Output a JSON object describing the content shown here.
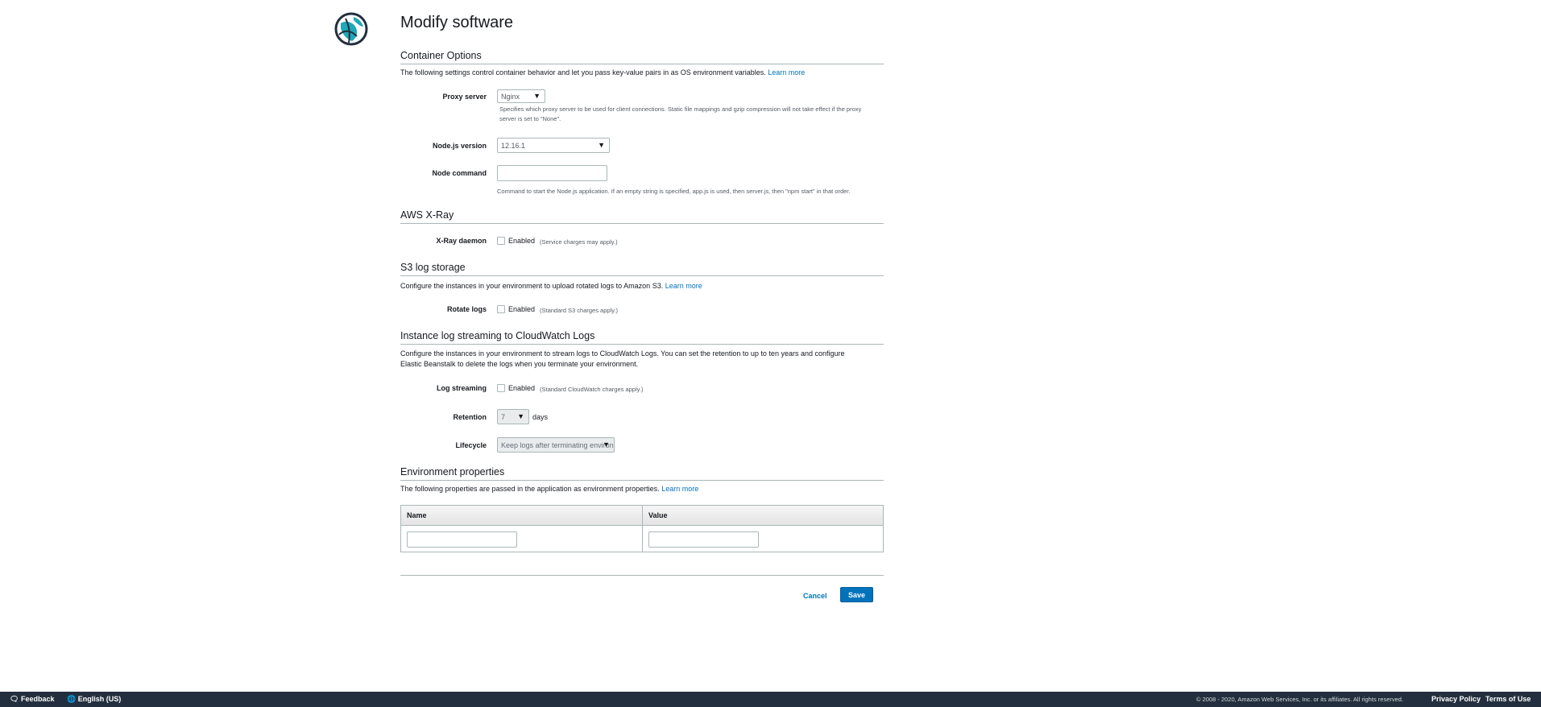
{
  "page_title": "Modify software",
  "container": {
    "heading": "Container Options",
    "description": "The following settings control container behavior and let you pass key-value pairs in as OS environment variables.",
    "learn_more": "Learn more",
    "proxy": {
      "label": "Proxy server",
      "value": "Nginx",
      "help": "Specifies which proxy server to be used for client connections. Static file mappings and gzip compression will not take effect if the proxy server is set to \"None\"."
    },
    "node_version": {
      "label": "Node.js version",
      "value": "12.16.1"
    },
    "node_command": {
      "label": "Node command",
      "value": "",
      "help": "Command to start the Node.js application. If an empty string is specified, app.js is used, then server.js, then \"npm start\" in that order."
    }
  },
  "xray": {
    "heading": "AWS X-Ray",
    "daemon": {
      "label": "X-Ray daemon",
      "checkbox_label": "Enabled",
      "checked": false,
      "note": "(Service charges may apply.)"
    }
  },
  "s3": {
    "heading": "S3 log storage",
    "description": "Configure the instances in your environment to upload rotated logs to Amazon S3.",
    "learn_more": "Learn more",
    "rotate": {
      "label": "Rotate logs",
      "checkbox_label": "Enabled",
      "checked": false,
      "note": "(Standard S3 charges apply.)"
    }
  },
  "cloudwatch": {
    "heading": "Instance log streaming to CloudWatch Logs",
    "description_line1": "Configure the instances in your environment to stream logs to CloudWatch Logs. You can set the retention to up to ten years and configure",
    "description_line2": "Elastic Beanstalk to delete the logs when you terminate your environment.",
    "streaming": {
      "label": "Log streaming",
      "checkbox_label": "Enabled",
      "checked": false,
      "note": "(Standard CloudWatch charges apply.)"
    },
    "retention": {
      "label": "Retention",
      "value": "7",
      "unit": "days"
    },
    "lifecycle": {
      "label": "Lifecycle",
      "value": "Keep logs after terminating environme"
    }
  },
  "env_props": {
    "heading": "Environment properties",
    "description": "The following properties are passed in the application as environment properties.",
    "learn_more": "Learn more",
    "columns": [
      "Name",
      "Value"
    ],
    "rows": [
      {
        "name": "",
        "value": ""
      }
    ]
  },
  "actions": {
    "cancel": "Cancel",
    "save": "Save"
  },
  "footer": {
    "feedback": "Feedback",
    "language": "English (US)",
    "copyright": "© 2008 - 2020, Amazon Web Services, Inc. or its affiliates. All rights reserved.",
    "privacy": "Privacy Policy",
    "terms": "Terms of Use"
  }
}
